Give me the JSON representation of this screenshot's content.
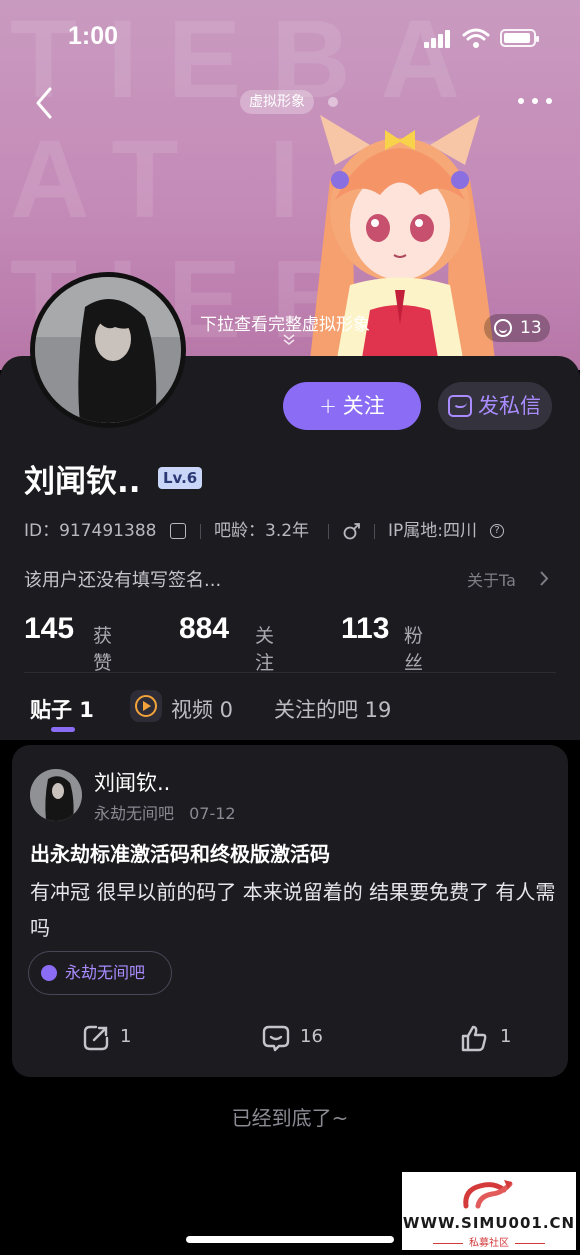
{
  "status_bar": {
    "time": "1:00"
  },
  "header": {
    "virtual_tag": "虚拟形象",
    "pull_hint": "下拉查看完整虚拟形象",
    "likes": "13"
  },
  "profile": {
    "follow_label": "关注",
    "message_label": "发私信",
    "username": "刘闻钦..",
    "level": "Lv.6",
    "id_text": "ID：917491388",
    "age_text": "吧龄：3.2年",
    "gender": "male",
    "ip_text": "IP属地:四川",
    "bio": "该用户还没有填写签名...",
    "about_label": "关于Ta",
    "stats": [
      {
        "num": "145",
        "label": "获赞"
      },
      {
        "num": "884",
        "label": "关注"
      },
      {
        "num": "113",
        "label": "粉丝"
      }
    ]
  },
  "tabs": [
    {
      "label": "贴子 1",
      "active": true
    },
    {
      "label": "视频 0",
      "active": false
    },
    {
      "label": "关注的吧 19",
      "active": false
    }
  ],
  "post": {
    "author": "刘闻钦..",
    "forum": "永劫无间吧",
    "date": "07-12",
    "title": "出永劫标准激活码和终极版激活码",
    "body": "有冲冠 很早以前的码了 本来说留着的 结果要免费了 有人需吗",
    "forum_tag": "永劫无间吧",
    "shares": "1",
    "comments": "16",
    "likes": "1"
  },
  "footer": {
    "end_text": "已经到底了~"
  },
  "watermark": {
    "site": "WWW.SIMU001.CN",
    "sub": "私募社区"
  },
  "colors": {
    "accent": "#8b6df5",
    "card": "#1c1b20",
    "background": "#000000"
  }
}
